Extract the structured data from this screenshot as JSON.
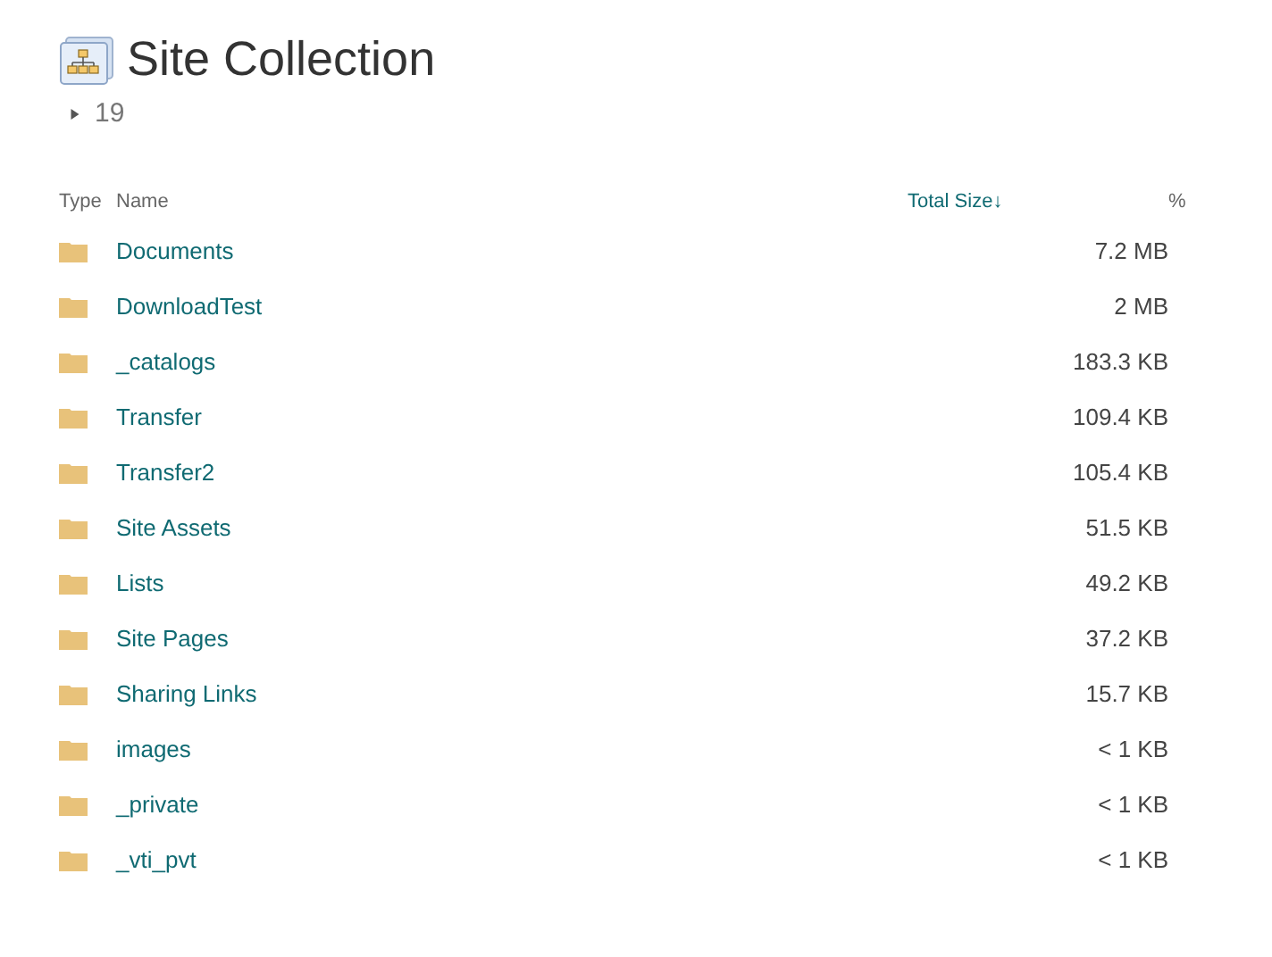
{
  "page": {
    "title": "Site Collection"
  },
  "summary": {
    "count": "19",
    "expanded": false
  },
  "table": {
    "columns": [
      {
        "label": "Type"
      },
      {
        "label": "Name"
      },
      {
        "label": "Total Size",
        "sort_indicator": "↓"
      },
      {
        "label": "%"
      }
    ],
    "rows": [
      {
        "name": "Documents",
        "size": "7.2 MB"
      },
      {
        "name": "DownloadTest",
        "size": "2 MB"
      },
      {
        "name": "_catalogs",
        "size": "183.3 KB"
      },
      {
        "name": "Transfer",
        "size": "109.4 KB"
      },
      {
        "name": "Transfer2",
        "size": "105.4 KB"
      },
      {
        "name": "Site Assets",
        "size": "51.5 KB"
      },
      {
        "name": "Lists",
        "size": "49.2 KB"
      },
      {
        "name": "Site Pages",
        "size": "37.2 KB"
      },
      {
        "name": "Sharing Links",
        "size": "15.7 KB"
      },
      {
        "name": "images",
        "size": "< 1 KB"
      },
      {
        "name": "_private",
        "size": "< 1 KB"
      },
      {
        "name": "_vti_pvt",
        "size": "< 1 KB"
      }
    ]
  }
}
